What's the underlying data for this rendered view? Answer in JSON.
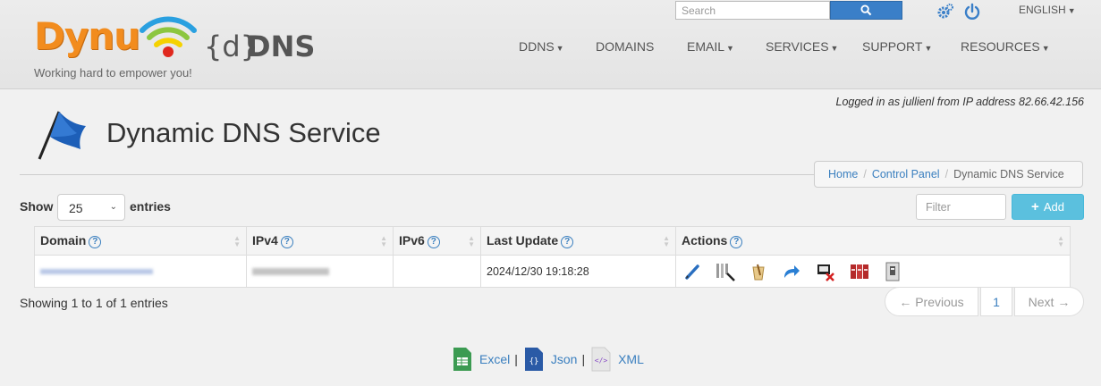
{
  "brand": {
    "logo_text": "Dynu",
    "logo_d": "{d}",
    "logo_dns": "DNS",
    "tagline": "Working hard to empower you!"
  },
  "topbar": {
    "search_placeholder": "Search",
    "language": "ENGLISH"
  },
  "nav": [
    {
      "label": "DDNS",
      "dropdown": true
    },
    {
      "label": "DOMAINS",
      "dropdown": false
    },
    {
      "label": "EMAIL",
      "dropdown": true
    },
    {
      "label": "SERVICES",
      "dropdown": true
    },
    {
      "label": "SUPPORT",
      "dropdown": true
    },
    {
      "label": "RESOURCES",
      "dropdown": true
    }
  ],
  "login_info": "Logged in as jullienl from IP address 82.66.42.156",
  "page_title": "Dynamic DNS Service",
  "breadcrumb": [
    "Home",
    "Control Panel",
    "Dynamic DNS Service"
  ],
  "controls": {
    "show_label": "Show",
    "page_size": "25",
    "entries_label": "entries",
    "filter_placeholder": "Filter",
    "add_label": "Add"
  },
  "table": {
    "columns": [
      "Domain",
      "IPv4",
      "IPv6",
      "Last Update",
      "Actions"
    ],
    "rows": [
      {
        "domain": "",
        "ipv4": "",
        "ipv6": "",
        "last_update": "2024/12/30 19:18:28"
      }
    ],
    "actions": [
      "edit-icon",
      "columns-search-icon",
      "history-icon",
      "forward-icon",
      "disable-icon",
      "records-icon",
      "archive-icon"
    ]
  },
  "summary": "Showing 1 to 1 of 1 entries",
  "pagination": {
    "previous": "← Previous",
    "page": "1",
    "next": "Next →"
  },
  "exports": [
    {
      "label": "Excel",
      "icon": "excel-icon",
      "color": "#3c9b52"
    },
    {
      "label": "Json",
      "icon": "json-icon",
      "color": "#2a5aa6"
    },
    {
      "label": "XML",
      "icon": "xml-icon",
      "color": "#8a4fc6"
    }
  ],
  "colors": {
    "accent": "#3a7fc8",
    "add_button": "#5bc0de",
    "logo_orange": "#f28c1e"
  }
}
